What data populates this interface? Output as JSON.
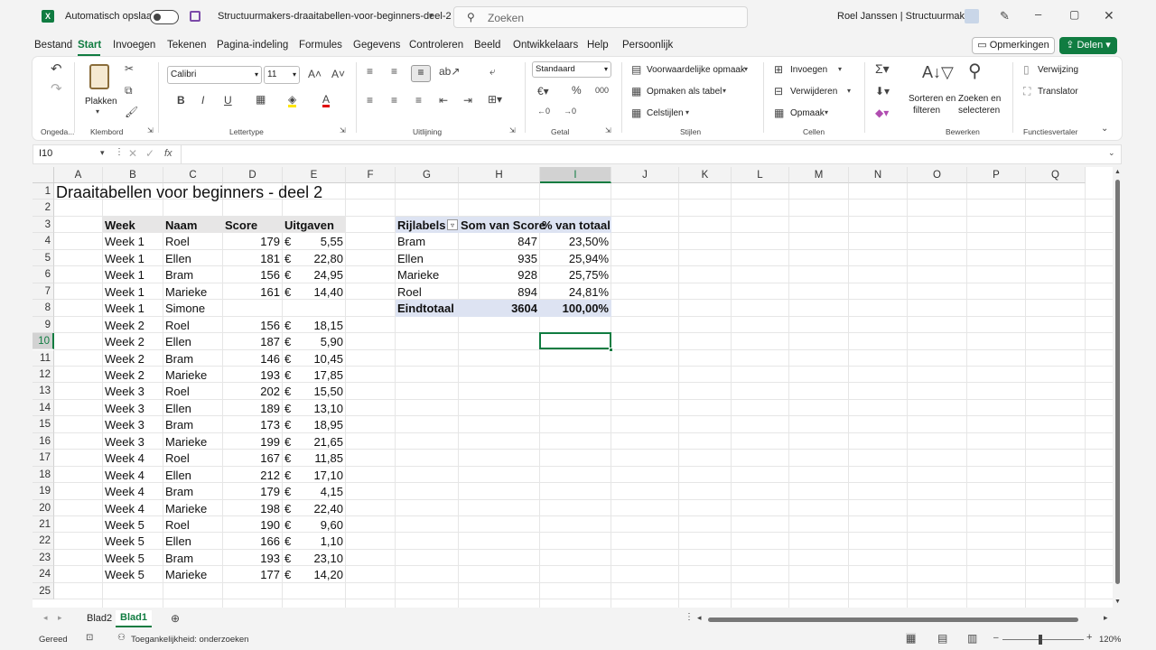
{
  "titlebar": {
    "autosave_label": "Automatisch opslaan",
    "filename": "Structuurmakers-draaitabellen-voor-beginners-deel-2",
    "search_placeholder": "Zoeken",
    "user": "Roel Janssen | Structuurmakers"
  },
  "menu": {
    "tabs": [
      "Bestand",
      "Start",
      "Invoegen",
      "Tekenen",
      "Pagina-indeling",
      "Formules",
      "Gegevens",
      "Controleren",
      "Beeld",
      "Ontwikkelaars",
      "Help",
      "Persoonlijk"
    ],
    "active": "Start",
    "comments": "Opmerkingen",
    "share": "Delen"
  },
  "ribbon": {
    "clipboard": {
      "label": "Klembord",
      "paste": "Plakken",
      "undo_label": "Ongeda..."
    },
    "font": {
      "label": "Lettertype",
      "name": "Calibri",
      "size": "11"
    },
    "alignment": {
      "label": "Uitlijning"
    },
    "number": {
      "label": "Getal",
      "format": "Standaard"
    },
    "styles": {
      "label": "Stijlen",
      "conditional": "Voorwaardelijke opmaak",
      "table": "Opmaken als tabel",
      "cell_styles": "Celstijlen"
    },
    "cells": {
      "label": "Cellen",
      "insert": "Invoegen",
      "delete": "Verwijderen",
      "format": "Opmaak"
    },
    "editing": {
      "label": "Bewerken",
      "sort_1": "Sorteren en",
      "sort_2": "filteren",
      "find_1": "Zoeken en",
      "find_2": "selecteren"
    },
    "addins": {
      "label": "Functiesvertaler",
      "ref": "Verwijzing",
      "translator": "Translator"
    }
  },
  "formula_bar": {
    "name_box": "I10",
    "fx": "fx",
    "content": ""
  },
  "columns": [
    "A",
    "B",
    "C",
    "D",
    "E",
    "F",
    "G",
    "H",
    "I",
    "J",
    "K",
    "L",
    "M",
    "N",
    "O",
    "P",
    "Q"
  ],
  "rows": [
    "1",
    "2",
    "3",
    "4",
    "5",
    "6",
    "7",
    "8",
    "9",
    "10",
    "11",
    "12",
    "13",
    "14",
    "15",
    "16",
    "17",
    "18",
    "19",
    "20",
    "21",
    "22",
    "23",
    "24",
    "25"
  ],
  "sheet_title": "Draaitabellen voor beginners - deel 2",
  "data_table": {
    "headers": [
      "Week",
      "Naam",
      "Score",
      "Uitgaven"
    ],
    "currency": "€",
    "rows": [
      [
        "Week 1",
        "Roel",
        "179",
        "5,55"
      ],
      [
        "Week 1",
        "Ellen",
        "181",
        "22,80"
      ],
      [
        "Week 1",
        "Bram",
        "156",
        "24,95"
      ],
      [
        "Week 1",
        "Marieke",
        "161",
        "14,40"
      ],
      [
        "Week 1",
        "Simone",
        "",
        ""
      ],
      [
        "Week 2",
        "Roel",
        "156",
        "18,15"
      ],
      [
        "Week 2",
        "Ellen",
        "187",
        "5,90"
      ],
      [
        "Week 2",
        "Bram",
        "146",
        "10,45"
      ],
      [
        "Week 2",
        "Marieke",
        "193",
        "17,85"
      ],
      [
        "Week 3",
        "Roel",
        "202",
        "15,50"
      ],
      [
        "Week 3",
        "Ellen",
        "189",
        "13,10"
      ],
      [
        "Week 3",
        "Bram",
        "173",
        "18,95"
      ],
      [
        "Week 3",
        "Marieke",
        "199",
        "21,65"
      ],
      [
        "Week 4",
        "Roel",
        "167",
        "11,85"
      ],
      [
        "Week 4",
        "Ellen",
        "212",
        "17,10"
      ],
      [
        "Week 4",
        "Bram",
        "179",
        "4,15"
      ],
      [
        "Week 4",
        "Marieke",
        "198",
        "22,40"
      ],
      [
        "Week 5",
        "Roel",
        "190",
        "9,60"
      ],
      [
        "Week 5",
        "Ellen",
        "166",
        "1,10"
      ],
      [
        "Week 5",
        "Bram",
        "193",
        "23,10"
      ],
      [
        "Week 5",
        "Marieke",
        "177",
        "14,20"
      ]
    ]
  },
  "pivot": {
    "headers": [
      "Rijlabels",
      "Som van Score",
      "% van totaal"
    ],
    "rows": [
      [
        "Bram",
        "847",
        "23,50%"
      ],
      [
        "Ellen",
        "935",
        "25,94%"
      ],
      [
        "Marieke",
        "928",
        "25,75%"
      ],
      [
        "Roel",
        "894",
        "24,81%"
      ]
    ],
    "total": [
      "Eindtotaal",
      "3604",
      "100,00%"
    ]
  },
  "sheets": {
    "tabs": [
      "Blad2",
      "Blad1"
    ],
    "active": "Blad1"
  },
  "status": {
    "ready": "Gereed",
    "accessibility": "Toegankelijkheid: onderzoeken",
    "zoom": "120%"
  },
  "colors": {
    "accent": "#107c41",
    "header_fill": "#e7e6e6",
    "pivot_fill": "#dde3f2",
    "selection": "#107c41"
  }
}
